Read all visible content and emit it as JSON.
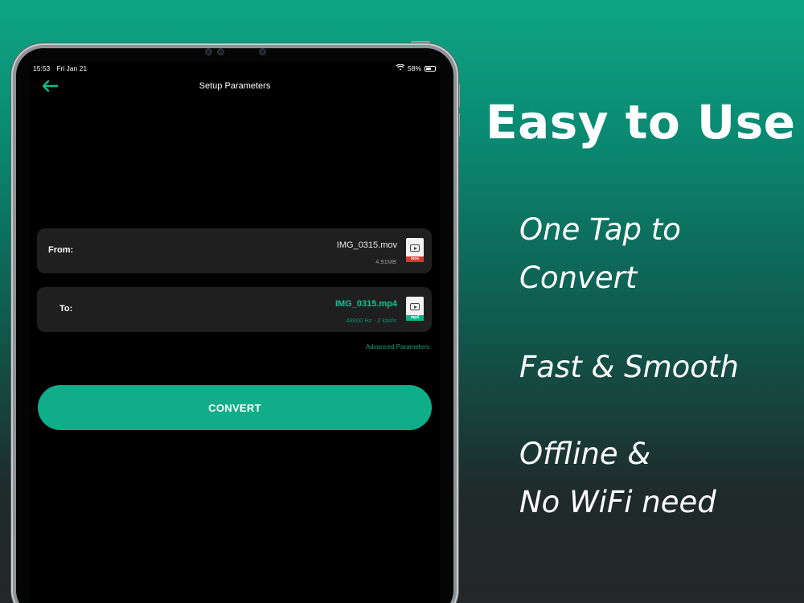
{
  "marketing": {
    "headline": "Easy to Use",
    "features": [
      "One Tap to\nConvert",
      "Fast & Smooth",
      "Offline &\nNo WiFi need"
    ]
  },
  "status_bar": {
    "time": "15:53",
    "date": "Fri Jan 21",
    "battery": "58%"
  },
  "nav": {
    "title": "Setup Parameters",
    "back_icon": "back-arrow-icon"
  },
  "from": {
    "label": "From:",
    "file_name": "IMG_0315.mov",
    "file_size": "4.91MB",
    "icon_tag": "mov"
  },
  "to": {
    "label": "To:",
    "file_name": "IMG_0315.mp4",
    "audio_params": "48000 Hz · 2 kbit/s",
    "icon_tag": "mp4"
  },
  "advanced_link": "Advanced Parameters",
  "convert_label": "CONVERT",
  "colors": {
    "accent": "#10ae88",
    "accent_text": "#10c496",
    "card_bg": "#1f1f1f",
    "mov_tag": "#e0332f"
  }
}
